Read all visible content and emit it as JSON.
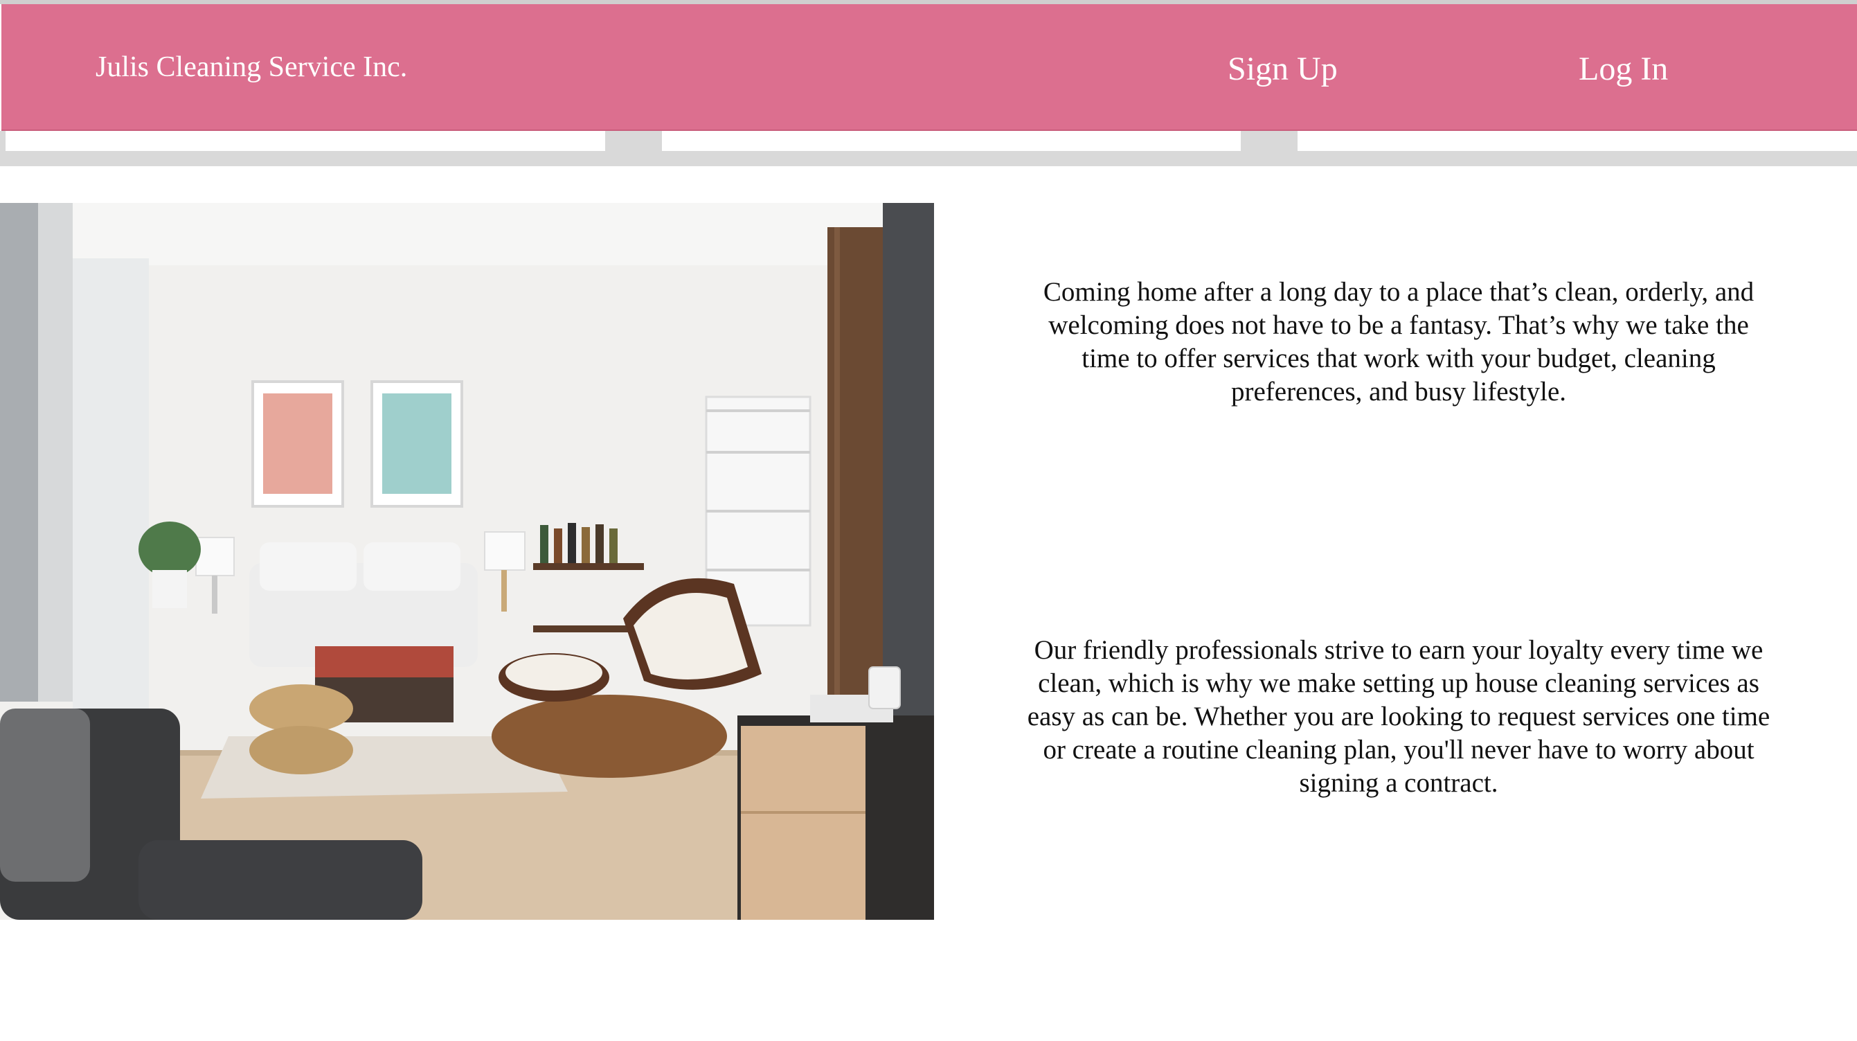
{
  "header": {
    "brand": "Julis Cleaning Service Inc.",
    "nav": {
      "signup_label": "Sign Up",
      "login_label": "Log In"
    }
  },
  "main": {
    "hero_image": {
      "subject": "living-room-photo"
    },
    "paragraphs": [
      "Coming home after a long day to a place that’s clean, orderly, and welcoming does not have to be a fantasy. That’s why we take the time to offer services that work with your budget, cleaning preferences, and busy lifestyle.",
      "Our friendly professionals strive to earn your loyalty every time we clean, which is why we make setting up house cleaning services as easy as can be. Whether you are looking to request services one time or create a routine cleaning plan, you'll never have to worry about signing a contract."
    ]
  },
  "colors": {
    "header_bg": "#dc6f8f",
    "header_text": "#ffffff",
    "tabbar_bg": "#d9d9d9",
    "body_text": "#111111"
  }
}
